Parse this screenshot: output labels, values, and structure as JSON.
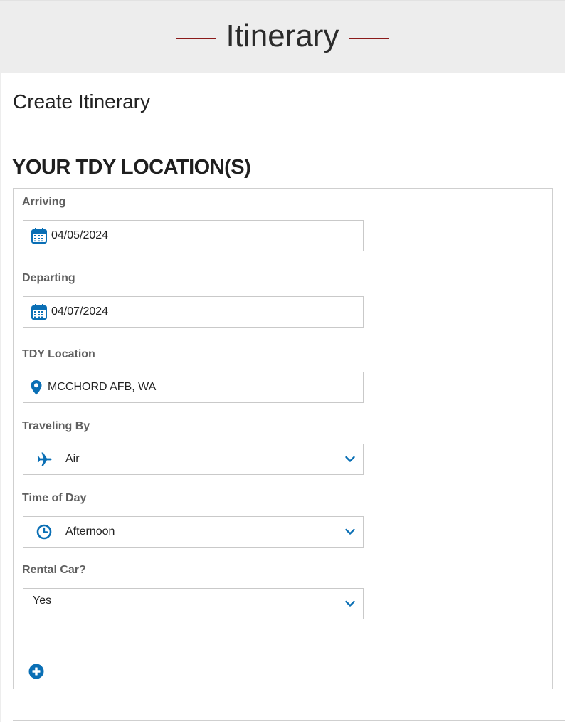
{
  "header": {
    "title": "Itinerary"
  },
  "page_title": "Create Itinerary",
  "tdy_section": {
    "heading": "YOUR TDY LOCATION(S)",
    "fields": {
      "arriving": {
        "label": "Arriving",
        "value": "04/05/2024",
        "icon": "calendar-icon"
      },
      "departing": {
        "label": "Departing",
        "value": "04/07/2024",
        "icon": "calendar-icon"
      },
      "tdy_location": {
        "label": "TDY Location",
        "value": "MCCHORD AFB, WA",
        "icon": "map-pin-icon"
      },
      "traveling_by": {
        "label": "Traveling By",
        "value": "Air",
        "icon": "airplane-icon"
      },
      "time_of_day": {
        "label": "Time of Day",
        "value": "Afternoon",
        "icon": "clock-icon"
      },
      "rental_car": {
        "label": "Rental Car?",
        "value": "Yes"
      }
    },
    "add_icon": "plus-circle-icon"
  },
  "colors": {
    "accent_blue": "#0a6fb5",
    "banner_rule": "#8b1a1a",
    "banner_bg": "#ededed"
  }
}
